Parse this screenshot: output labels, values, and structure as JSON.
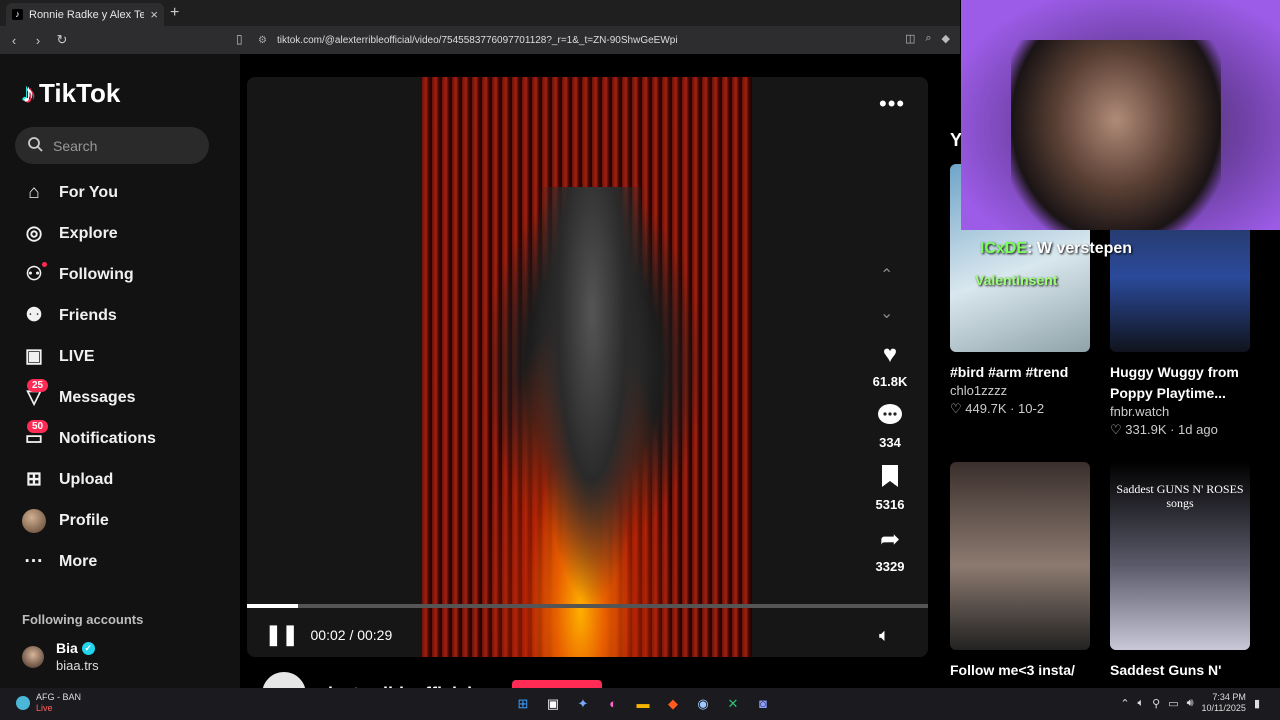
{
  "browser": {
    "tab_title": "Ronnie Radke y Alex Terrible",
    "url": "tiktok.com/@alexterribleofficial/video/7545583776097701128?_r=1&_t=ZN-90ShwGeEWpi"
  },
  "sidebar": {
    "logo": "TikTok",
    "search_placeholder": "Search",
    "nav": [
      {
        "label": "For You",
        "icon": "home-icon"
      },
      {
        "label": "Explore",
        "icon": "compass-icon"
      },
      {
        "label": "Following",
        "icon": "following-icon"
      },
      {
        "label": "Friends",
        "icon": "friends-icon"
      },
      {
        "label": "LIVE",
        "icon": "live-icon"
      },
      {
        "label": "Messages",
        "icon": "messages-icon",
        "badge": "25"
      },
      {
        "label": "Notifications",
        "icon": "notifications-icon",
        "badge": "50"
      },
      {
        "label": "Upload",
        "icon": "upload-icon"
      },
      {
        "label": "Profile",
        "icon": "profile-icon"
      },
      {
        "label": "More",
        "icon": "more-icon"
      }
    ],
    "following_heading": "Following accounts",
    "account": {
      "name": "Bia",
      "handle": "biaa.trs"
    }
  },
  "player": {
    "likes": "61.8K",
    "comments": "334",
    "saves": "5316",
    "shares": "3329",
    "time": "00:02 / 00:29",
    "progress": 0.075,
    "author": "alexterribleofficial"
  },
  "right": {
    "heading": "Y",
    "cards": [
      {
        "title": "#bird #arm #trend",
        "user": "chlo1zzzz",
        "likes": "449.7K",
        "date": "10-2"
      },
      {
        "title": "Huggy Wuggy from Poppy Playtime...",
        "user": "fnbr.watch",
        "likes": "331.9K",
        "date": "1d ago"
      },
      {
        "title": "Follow me<3 insta/",
        "user": "",
        "likes": "",
        "date": ""
      },
      {
        "title": "Saddest Guns N'",
        "user": "",
        "likes": "",
        "date": ""
      }
    ],
    "thumb_text": "Saddest GUNS N' ROSES songs"
  },
  "stream_overlay": {
    "line1_a": "ICxDE",
    "line1_b": ": W verstepen",
    "line2": "Valentinsent"
  },
  "taskbar": {
    "weather_title": "AFG - BAN",
    "weather_sub": "Live",
    "time": "7:34 PM",
    "date": "10/11/2025"
  }
}
